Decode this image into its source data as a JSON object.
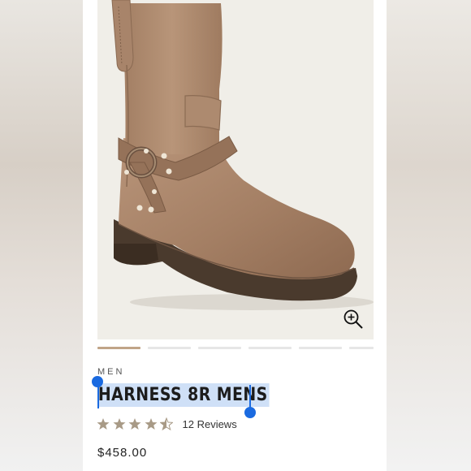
{
  "product": {
    "category": "MEN",
    "title": "HARNESS 8R MENS",
    "rating": 4.5,
    "rating_max": 5,
    "reviews_label": "12 Reviews",
    "price": "$458.00"
  },
  "gallery": {
    "slide_count": 6,
    "active_slide": 1,
    "zoom_icon": "zoom-in-icon"
  },
  "colors": {
    "selection_highlight": "#cfe0f7",
    "selection_handle": "#1a6ae0",
    "star": "#a89a86",
    "carousel_active": "#c0a487"
  }
}
